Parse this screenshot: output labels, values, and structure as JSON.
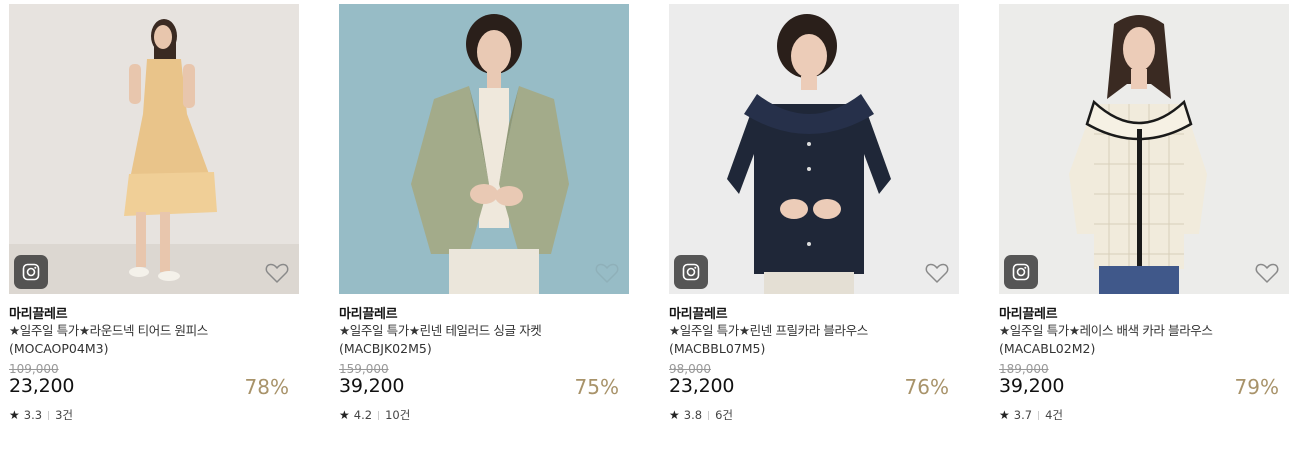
{
  "colors": {
    "discount": "#a8936a",
    "price": "#111111",
    "original_price": "#999999"
  },
  "products": [
    {
      "brand": "마리끌레르",
      "name": "★일주일 특가★라운드넥 티어드 원피스",
      "code": "(MOCAOP04M3)",
      "original_price": "109,000",
      "price": "23,200",
      "discount": "78%",
      "rating": "3.3",
      "reviews": "3건",
      "has_instagram": true,
      "photo_bg": "#e7e3df",
      "garment": "#e9c48a"
    },
    {
      "brand": "마리끌레르",
      "name": "★일주일 특가★린넨 테일러드 싱글 자켓",
      "code": "(MACBJK02M5)",
      "original_price": "159,000",
      "price": "39,200",
      "discount": "75%",
      "rating": "4.2",
      "reviews": "10건",
      "has_instagram": false,
      "photo_bg": "#97bcc6",
      "garment": "#a3ab8a"
    },
    {
      "brand": "마리끌레르",
      "name": "★일주일 특가★린넨 프릴카라 블라우스",
      "code": "(MACBBL07M5)",
      "original_price": "98,000",
      "price": "23,200",
      "discount": "76%",
      "rating": "3.8",
      "reviews": "6건",
      "has_instagram": true,
      "photo_bg": "#ececec",
      "garment": "#1f2738"
    },
    {
      "brand": "마리끌레르",
      "name": "★일주일 특가★레이스 배색 카라 블라우스",
      "code": "(MACABL02M2)",
      "original_price": "189,000",
      "price": "39,200",
      "discount": "79%",
      "rating": "3.7",
      "reviews": "4건",
      "has_instagram": true,
      "photo_bg": "#ececea",
      "garment": "#f1ebdc"
    }
  ]
}
